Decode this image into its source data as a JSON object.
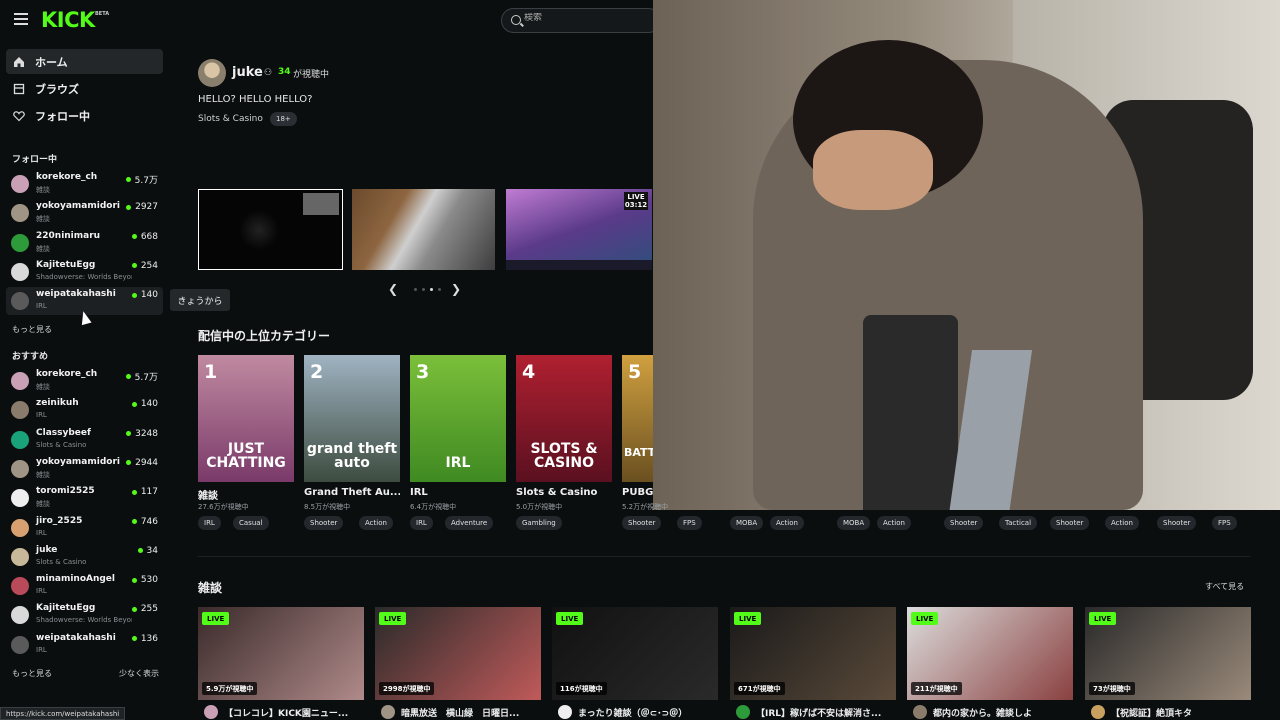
{
  "header": {
    "logo": "KICK",
    "logo_badge": "BETA",
    "search_placeholder": "検索"
  },
  "sidebar": {
    "nav": [
      {
        "label": "ホーム",
        "icon": "home-icon",
        "active": true
      },
      {
        "label": "ブラウズ",
        "icon": "browse-icon",
        "active": false
      },
      {
        "label": "フォロー中",
        "icon": "heart-icon",
        "active": false
      }
    ],
    "following_title": "フォロー中",
    "following": [
      {
        "name": "korekore_ch",
        "category": "雑談",
        "viewers": "5.7万",
        "avatar_color": "#c9a0b6"
      },
      {
        "name": "yokoyamamidori",
        "category": "雑談",
        "viewers": "2927",
        "avatar_color": "#a09585"
      },
      {
        "name": "220ninimaru",
        "category": "雑談",
        "viewers": "668",
        "avatar_color": "#2e9b3a"
      },
      {
        "name": "KajitetuEgg",
        "category": "Shadowverse: Worlds Beyond",
        "viewers": "254",
        "avatar_color": "#d9d9d9"
      },
      {
        "name": "weipatakahashi",
        "category": "IRL",
        "viewers": "140",
        "avatar_color": "#5a5a5a"
      }
    ],
    "following_more": "もっと見る",
    "recommended_title": "おすすめ",
    "recommended": [
      {
        "name": "korekore_ch",
        "category": "雑談",
        "viewers": "5.7万",
        "avatar_color": "#c9a0b6"
      },
      {
        "name": "zeinikuh",
        "category": "IRL",
        "viewers": "140",
        "avatar_color": "#8a7b6a"
      },
      {
        "name": "Classybeef",
        "category": "Slots & Casino",
        "viewers": "3248",
        "avatar_color": "#1aa37a"
      },
      {
        "name": "yokoyamamidori",
        "category": "雑談",
        "viewers": "2944",
        "avatar_color": "#a09585"
      },
      {
        "name": "toromi2525",
        "category": "雑談",
        "viewers": "117",
        "avatar_color": "#eeeeee"
      },
      {
        "name": "jiro_2525",
        "category": "IRL",
        "viewers": "746",
        "avatar_color": "#d8a070"
      },
      {
        "name": "juke",
        "category": "Slots & Casino",
        "viewers": "34",
        "avatar_color": "#c8b89a"
      },
      {
        "name": "minaminoAngel",
        "category": "IRL",
        "viewers": "530",
        "avatar_color": "#b84a5a"
      },
      {
        "name": "KajitetuEgg",
        "category": "Shadowverse: Worlds Beyond",
        "viewers": "255",
        "avatar_color": "#d9d9d9"
      },
      {
        "name": "weipatakahashi",
        "category": "IRL",
        "viewers": "136",
        "avatar_color": "#5a5a5a"
      }
    ],
    "recommended_more": "もっと見る",
    "recommended_less": "少なく表示",
    "tooltip": "きょうから"
  },
  "featured": {
    "streamer": "juke",
    "viewer_count": "34",
    "viewer_suffix": "が視聴中",
    "title": "HELLO? HELLO HELLO?",
    "category": "Slots & Casino",
    "badge": "18+",
    "thumb_live_label": "LIVE",
    "thumb_time": "03:12"
  },
  "top_categories": {
    "title": "配信中の上位カテゴリー",
    "items": [
      {
        "rank": "1",
        "art": "JUST CHATTING",
        "name": "雑談",
        "views": "27.6万が視聴中",
        "tags": [
          "IRL",
          "Casual"
        ],
        "bg": "linear-gradient(180deg,#c08aa0,#7a3a6a)"
      },
      {
        "rank": "2",
        "art": "grand theft auto",
        "name": "Grand Theft Au...",
        "views": "8.5万が視聴中",
        "tags": [
          "Shooter",
          "Action"
        ],
        "bg": "linear-gradient(180deg,#9fb3c2,#3d4c3f)"
      },
      {
        "rank": "3",
        "art": "IRL",
        "name": "IRL",
        "views": "6.4万が視聴中",
        "tags": [
          "IRL",
          "Adventure"
        ],
        "bg": "linear-gradient(180deg,#7bbf3a,#3f8a22)"
      },
      {
        "rank": "4",
        "art": "SLOTS & CASINO",
        "name": "Slots & Casino",
        "views": "5.0万が視聴中",
        "tags": [
          "Gambling"
        ],
        "bg": "linear-gradient(180deg,#b02030,#5a1020)"
      },
      {
        "rank": "5",
        "art": "BATTL",
        "name": "PUBG",
        "views": "5.2万が視聴中",
        "tags": [
          "Shooter",
          "FPS"
        ],
        "bg": "linear-gradient(180deg,#d0a040,#6a5020)"
      }
    ],
    "hidden_tags": [
      [
        "MOBA",
        "Action"
      ],
      [
        "MOBA",
        "Action"
      ],
      [
        "Shooter",
        "Tactical"
      ],
      [
        "Shooter",
        "Action"
      ],
      [
        "Shooter",
        "FPS"
      ]
    ]
  },
  "zatsudan": {
    "title": "雑談",
    "see_all": "すべて見る",
    "live_label": "LIVE",
    "streams": [
      {
        "views": "5.9万が視聴中",
        "title": "【コレコレ】KICK園ニュー...",
        "bg": "linear-gradient(135deg,#3a2a2a,#b08a8a)",
        "avatar_color": "#c9a0b6"
      },
      {
        "views": "2998が視聴中",
        "title": "暗黒放送　横山緑　日曜日...",
        "bg": "linear-gradient(135deg,#2a2a2a,#c05a5a)",
        "avatar_color": "#a09585"
      },
      {
        "views": "116が視聴中",
        "title": "まったり雑談（＠⊂･⊃＠）",
        "bg": "linear-gradient(135deg,#111,#2a2a2a)",
        "avatar_color": "#eeeeee"
      },
      {
        "views": "671が視聴中",
        "title": "【IRL】稼げば不安は解消さ...",
        "bg": "linear-gradient(135deg,#1a1a1a,#5a4a3a)",
        "avatar_color": "#2e9b3a"
      },
      {
        "views": "211が視聴中",
        "title": "都内の家から。雑談しよ",
        "bg": "linear-gradient(135deg,#dcdcdc,#8a4040)",
        "avatar_color": "#8a7b6a"
      },
      {
        "views": "73が視聴中",
        "title": "【祝認証】絶頂キタ",
        "bg": "linear-gradient(135deg,#2a2a2a,#9a8a7a)",
        "avatar_color": "#c8a060"
      }
    ]
  },
  "status_url": "https://kick.com/weipatakahashi",
  "colors": {
    "accent": "#53fc18",
    "background": "#0b0e0f"
  }
}
